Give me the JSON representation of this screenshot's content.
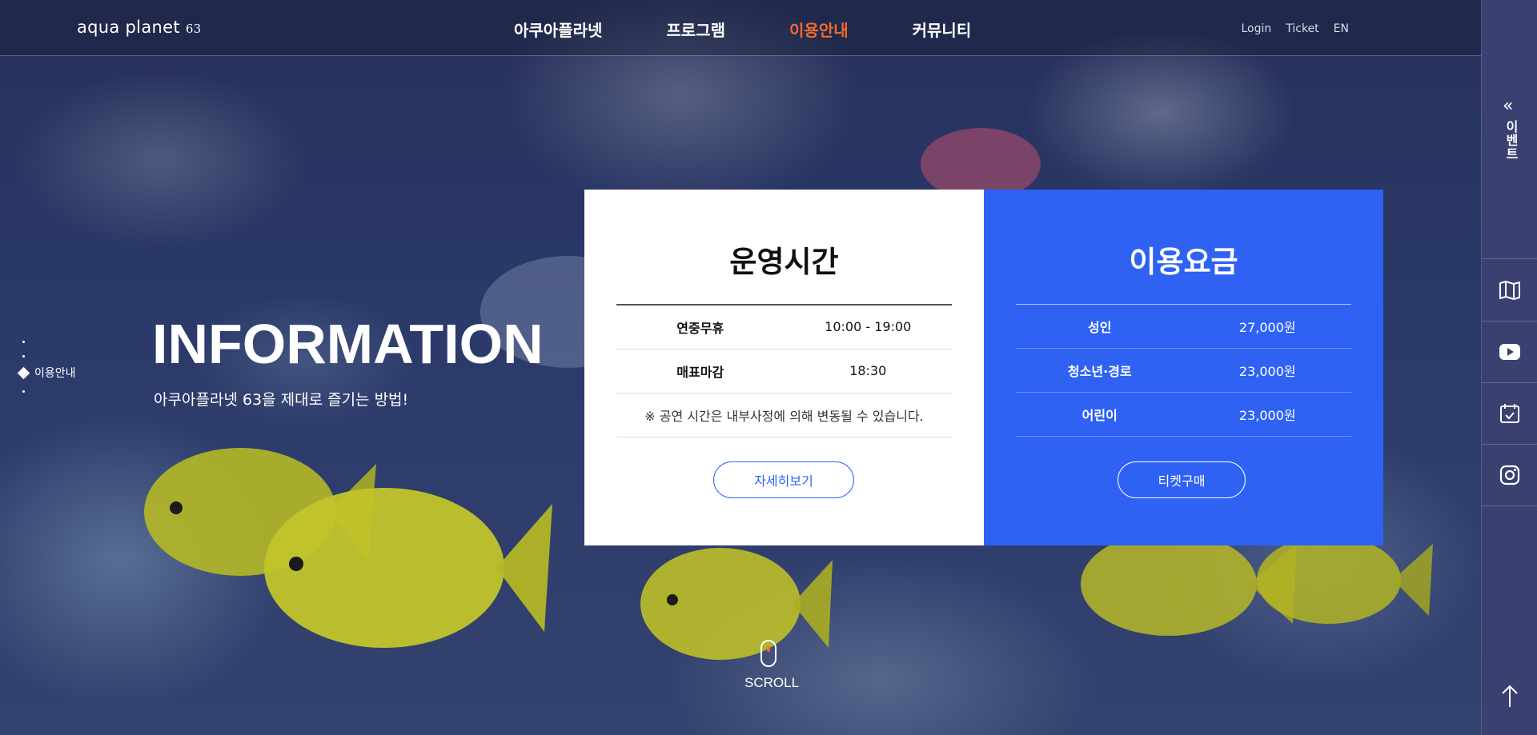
{
  "header": {
    "logo_text": "aqua planet",
    "logo_num": "63",
    "nav": [
      {
        "label": "아쿠아플라넷",
        "active": false
      },
      {
        "label": "프로그램",
        "active": false
      },
      {
        "label": "이용안내",
        "active": true
      },
      {
        "label": "커뮤니티",
        "active": false
      }
    ],
    "util": {
      "login": "Login",
      "ticket": "Ticket",
      "lang": "EN"
    }
  },
  "quickbar": {
    "event_label": "이벤트",
    "icons": [
      "map-icon",
      "youtube-icon",
      "calendar-check-icon",
      "instagram-icon"
    ]
  },
  "indicator": {
    "current": "이용안내"
  },
  "hero": {
    "title": "INFORMATION",
    "subtitle": "아쿠아플라넷 63을 제대로 즐기는 방법!"
  },
  "hours": {
    "title": "운영시간",
    "rows": [
      {
        "key": "연중무휴",
        "value": "10:00 - 19:00"
      },
      {
        "key": "매표마감",
        "value": "18:30"
      }
    ],
    "note": "※ 공연 시간은 내부사정에 의해 변동될 수 있습니다.",
    "button": "자세히보기"
  },
  "price": {
    "title": "이용요금",
    "rows": [
      {
        "key": "성인",
        "value": "27,000원"
      },
      {
        "key": "청소년·경로",
        "value": "23,000원"
      },
      {
        "key": "어린이",
        "value": "23,000원"
      }
    ],
    "button": "티켓구매"
  },
  "scroll": {
    "label": "SCROLL"
  },
  "colors": {
    "accent_orange": "#f26a2e",
    "card_blue": "#2f62f3"
  }
}
